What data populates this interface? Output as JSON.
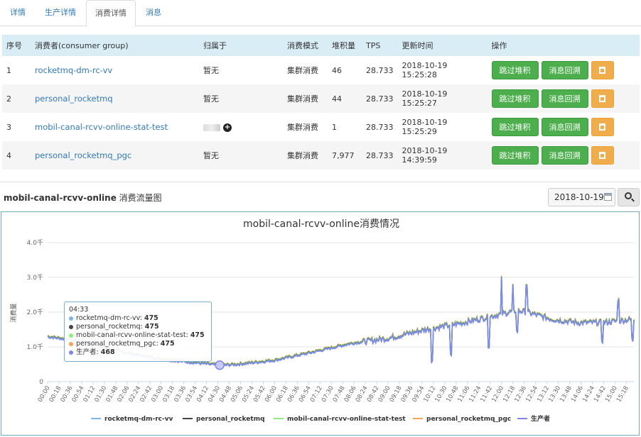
{
  "tabs": [
    {
      "label": "详情",
      "active": false
    },
    {
      "label": "生产详情",
      "active": false
    },
    {
      "label": "消费详情",
      "active": true
    },
    {
      "label": "消息",
      "active": false
    }
  ],
  "table": {
    "headers": [
      "序号",
      "消费者(consumer group)",
      "归属于",
      "消费模式",
      "堆积量",
      "TPS",
      "更新时间",
      "操作"
    ],
    "rows": [
      {
        "idx": "1",
        "group": "rocketmq-dm-rc-vv",
        "owner": "暂无",
        "mode": "集群消费",
        "backlog": "46",
        "tps": "28.733",
        "time": "2018-10-19 15:25:28"
      },
      {
        "idx": "2",
        "group": "personal_rocketmq",
        "owner": "暂无",
        "mode": "集群消费",
        "backlog": "44",
        "tps": "28.733",
        "time": "2018-10-19 15:25:27"
      },
      {
        "idx": "3",
        "group": "mobil-canal-rcvv-online-stat-test",
        "owner": "",
        "mode": "集群消费",
        "backlog": "1",
        "tps": "28.733",
        "time": "2018-10-19 15:25:29"
      },
      {
        "idx": "4",
        "group": "personal_rocketmq_pgc",
        "owner": "暂无",
        "mode": "集群消费",
        "backlog": "7,977",
        "tps": "28.733",
        "time": "2018-10-19 14:39:59"
      }
    ],
    "actions": {
      "skip": "跳过堆积",
      "rewind": "消息回溯"
    }
  },
  "section": {
    "name": "mobil-canal-rcvv-online",
    "suffix": " 消费流量图"
  },
  "date_value": "2018-10-19",
  "tooltip": {
    "time": "04:33",
    "rows": [
      {
        "name": "rocketmq-dm-rc-vv",
        "value": "475",
        "color": "#7cb5ec"
      },
      {
        "name": "personal_rocketmq",
        "value": "475",
        "color": "#434348"
      },
      {
        "name": "mobil-canal-rcvv-online-stat-test",
        "value": "475",
        "color": "#90ed7d"
      },
      {
        "name": "personal_rocketmq_pgc",
        "value": "475",
        "color": "#f7a35c"
      },
      {
        "name": "生产者",
        "value": "468",
        "color": "#8085e9"
      }
    ]
  },
  "chart_data": {
    "type": "line",
    "title": "mobil-canal-rcvv-online消费情况",
    "ylabel": "消费量",
    "ylim": [
      0,
      4000
    ],
    "y_ticks": [
      "0",
      "1.0千",
      "2.0千",
      "3.0千",
      "4.0千"
    ],
    "x_ticks": [
      "00:00",
      "00:18",
      "00:36",
      "00:54",
      "01:12",
      "01:30",
      "01:48",
      "02:06",
      "02:24",
      "02:42",
      "03:00",
      "03:18",
      "03:36",
      "03:54",
      "04:12",
      "04:30",
      "04:48",
      "05:06",
      "05:24",
      "05:42",
      "06:00",
      "06:18",
      "06:36",
      "06:54",
      "07:12",
      "07:30",
      "07:48",
      "08:06",
      "08:24",
      "08:42",
      "09:00",
      "09:18",
      "09:36",
      "09:54",
      "10:12",
      "10:30",
      "10:48",
      "11:06",
      "11:24",
      "11:42",
      "12:00",
      "12:18",
      "12:36",
      "12:54",
      "13:12",
      "13:30",
      "13:48",
      "14:06",
      "14:24",
      "14:42",
      "15:00",
      "15:18"
    ],
    "x_minutes": [
      0,
      60,
      120,
      180,
      240,
      273,
      300,
      360,
      420,
      480,
      540,
      600,
      660,
      720,
      745,
      760,
      800,
      840,
      880,
      930
    ],
    "values": [
      1300,
      1150,
      850,
      650,
      540,
      475,
      500,
      620,
      850,
      1100,
      1250,
      1500,
      1700,
      1950,
      2050,
      2000,
      1800,
      1700,
      1700,
      1800
    ],
    "series": [
      {
        "name": "rocketmq-dm-rc-vv",
        "color": "#7cb5ec"
      },
      {
        "name": "personal_rocketmq",
        "color": "#434348"
      },
      {
        "name": "mobil-canal-rcvv-online-stat-test",
        "color": "#90ed7d"
      },
      {
        "name": "personal_rocketmq_pgc",
        "color": "#f7a35c"
      },
      {
        "name": "生产者",
        "color": "#8085e9"
      }
    ],
    "legend_position": "bottom"
  }
}
